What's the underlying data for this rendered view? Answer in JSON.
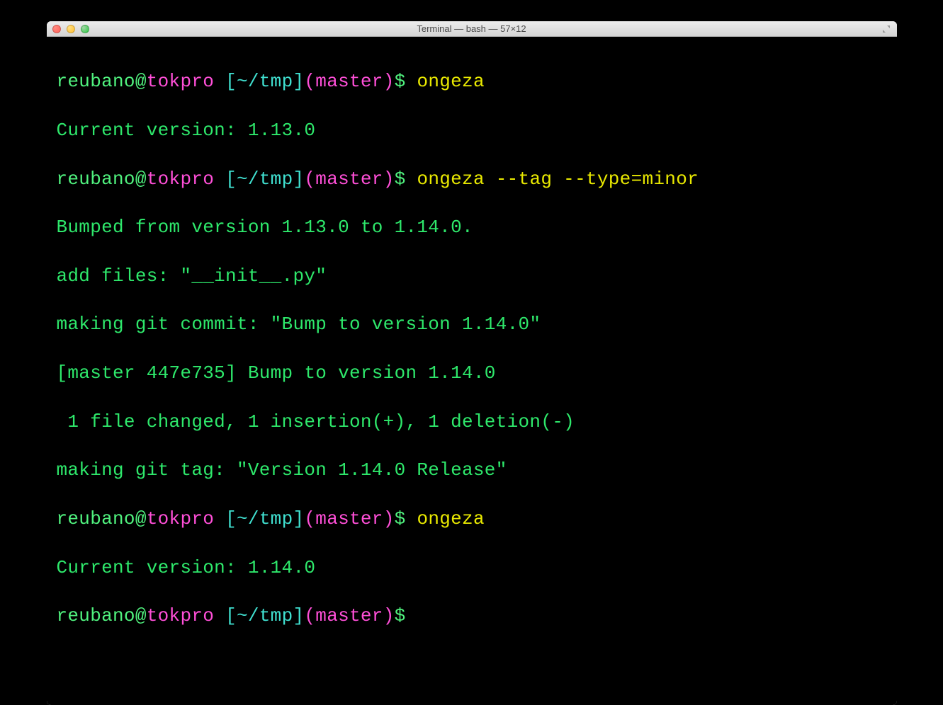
{
  "window": {
    "title": "Terminal — bash — 57×12"
  },
  "prompt": {
    "user": "reubano",
    "at": "@",
    "host": "tokpro",
    "space": " ",
    "path": "[~/tmp]",
    "branch": "(master)",
    "sigil": "$ "
  },
  "commands": {
    "cmd1": "ongeza",
    "cmd2": "ongeza --tag --type=minor",
    "cmd3": "ongeza"
  },
  "output": {
    "ver_before": "Current version: 1.13.0",
    "bump": "Bumped from version 1.13.0 to 1.14.0.",
    "addfiles": "add files: \"__init__.py\"",
    "commit": "making git commit: \"Bump to version 1.14.0\"",
    "commitres": "[master 447e735] Bump to version 1.14.0",
    "stats": " 1 file changed, 1 insertion(+), 1 deletion(-)",
    "tag": "making git tag: \"Version 1.14.0 Release\"",
    "ver_after": "Current version: 1.14.0"
  }
}
